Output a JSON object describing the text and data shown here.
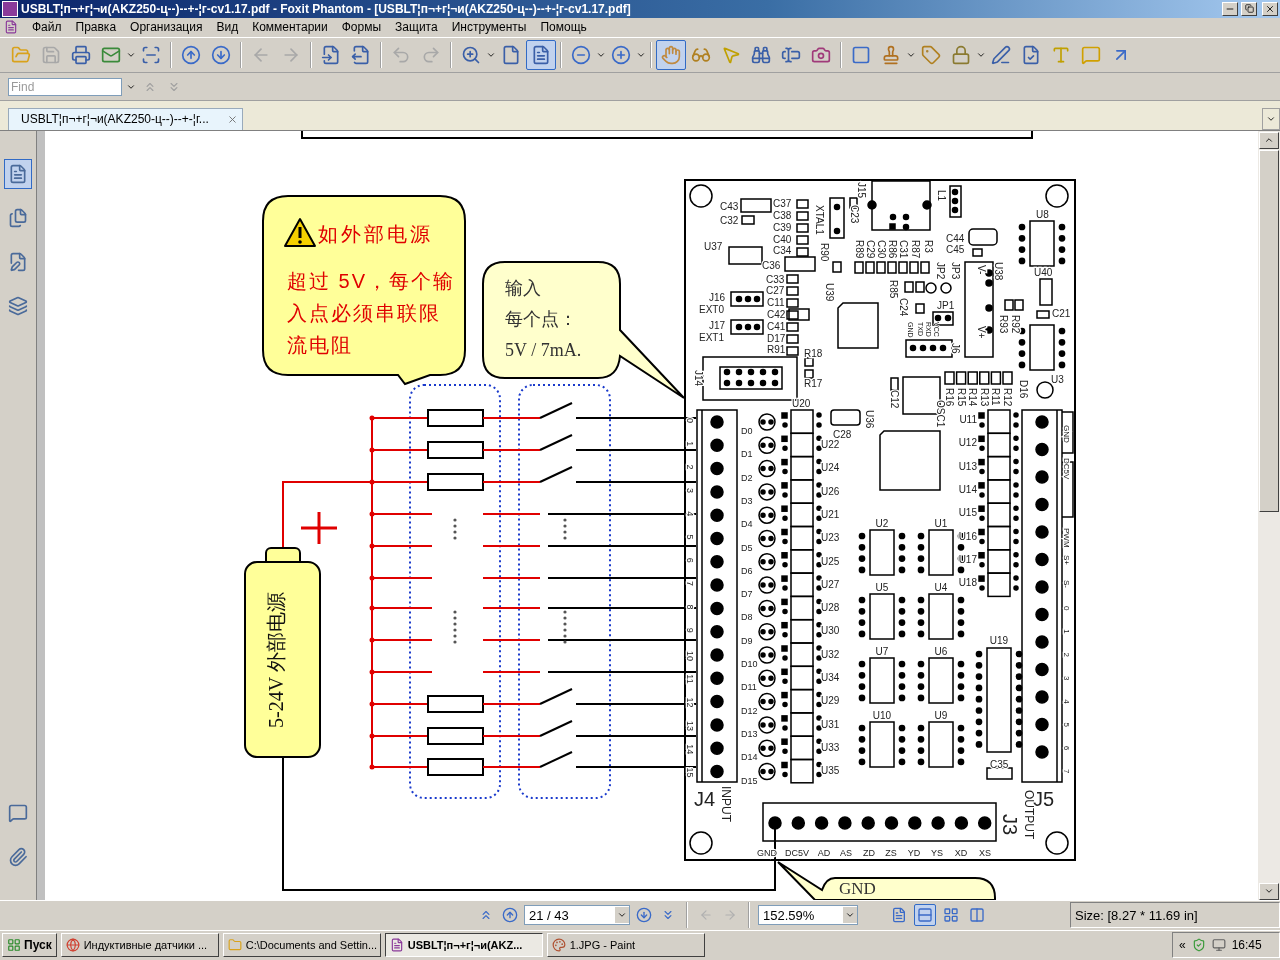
{
  "window": {
    "title": "USBLT¦п¬+г¦¬и(AKZ250-ц--)--+-¦г-cv1.17.pdf - Foxit Phantom - [USBLT¦п¬+г¦¬и(AKZ250-ц--)--+-¦г-cv1.17.pdf]"
  },
  "menu": [
    "Файл",
    "Правка",
    "Организация",
    "Вид",
    "Комментарии",
    "Формы",
    "Защита",
    "Инструменты",
    "Помощь"
  ],
  "toolbar": [
    {
      "selected": false,
      "disabled": false
    },
    {
      "selected": false,
      "disabled": true
    },
    {
      "selected": false,
      "disabled": false
    },
    {
      "selected": false,
      "disabled": false
    },
    {
      "selected": false,
      "disabled": false
    },
    {
      "selected": false,
      "disabled": false
    },
    {
      "selected": false,
      "disabled": false
    },
    {
      "selected": false,
      "disabled": true
    },
    {
      "selected": false,
      "disabled": true
    },
    {
      "selected": false,
      "disabled": false
    },
    {
      "selected": false,
      "disabled": false
    },
    {
      "selected": false,
      "disabled": true
    },
    {
      "selected": false,
      "disabled": true
    },
    {
      "selected": false,
      "disabled": false
    },
    {
      "selected": false,
      "disabled": false
    },
    {
      "selected": true,
      "disabled": false
    },
    {
      "selected": false,
      "disabled": false
    },
    {
      "selected": false,
      "disabled": false
    },
    {
      "selected": true,
      "disabled": false
    },
    {
      "selected": false,
      "disabled": false
    },
    {
      "selected": false,
      "disabled": false
    },
    {
      "selected": false,
      "disabled": false
    },
    {
      "selected": false,
      "disabled": false
    },
    {
      "selected": false,
      "disabled": false
    },
    {
      "selected": false,
      "disabled": false
    },
    {
      "selected": false,
      "disabled": false
    },
    {
      "selected": false,
      "disabled": false
    },
    {
      "selected": false,
      "disabled": false
    },
    {
      "selected": false,
      "disabled": false
    },
    {
      "selected": false,
      "disabled": false
    },
    {
      "selected": false,
      "disabled": false
    },
    {
      "selected": false,
      "disabled": false
    },
    {
      "selected": false,
      "disabled": false
    }
  ],
  "find": {
    "placeholder": "Find"
  },
  "tabs": [
    {
      "label": "USBLT¦п¬+г¦¬и(AKZ250-ц--)--+-¦г...",
      "selected": true
    }
  ],
  "sidebar": [
    {
      "selected": true
    },
    {
      "selected": false
    },
    {
      "selected": false
    },
    {
      "selected": false
    },
    {
      "selected": false
    },
    {
      "selected": false
    }
  ],
  "diagram": {
    "warning_callout": {
      "title": "如外部电源",
      "text": "超过 5V，每个输入点必须串联限流电阻"
    },
    "input_callout": {
      "lines": [
        "输入",
        "每个点：",
        "5V / 7mA."
      ]
    },
    "gnd_callout": {
      "text": "GND"
    },
    "power_supply": {
      "label": "5-24V  外部电源"
    },
    "board": {
      "labels": [
        "C43",
        "C32",
        "C37",
        "C38",
        "C39",
        "C40",
        "C34",
        "U37",
        "C36",
        "C33",
        "C27",
        "C11",
        "C42",
        "C41",
        "D17",
        "R91",
        "J16",
        "EXT0",
        "J17",
        "EXT1",
        "R18",
        "R17",
        "J14",
        "XTAL1",
        "C23",
        "R90",
        "U39",
        "J15",
        "R89",
        "C29",
        "C30",
        "R86",
        "C31",
        "R87",
        "R3",
        "R85",
        "C24",
        "JP2",
        "JP3",
        "JP1",
        "J6",
        "L1",
        "C44",
        "C45",
        "U38",
        "V-",
        "V+",
        "U8",
        "U40",
        "C21",
        "R92",
        "R93",
        "U3",
        "D16",
        "R16",
        "R15",
        "R14",
        "R13",
        "R11",
        "R12",
        "C12",
        "OSC1",
        "U36",
        "C28",
        "C35",
        "GND",
        "TXD",
        "RXD",
        "VCC"
      ],
      "input_terminal": {
        "name": "J4",
        "caption": "INPUT",
        "pins": [
          "0",
          "1",
          "2",
          "3",
          "4",
          "5",
          "6",
          "7",
          "8",
          "9",
          "10",
          "11",
          "12",
          "13",
          "14",
          "15"
        ]
      },
      "leds": [
        "D0",
        "D1",
        "D2",
        "D3",
        "D4",
        "D5",
        "D6",
        "D7",
        "D8",
        "D9",
        "D10",
        "D11",
        "D12",
        "D13",
        "D14",
        "D15"
      ],
      "input_relays": [
        "U20",
        "U22",
        "U24",
        "U26",
        "U21",
        "U23",
        "U25",
        "U27",
        "U28",
        "U30",
        "U32",
        "U34",
        "U29",
        "U31",
        "U33",
        "U35"
      ],
      "output_relays": [
        "U11",
        "U12",
        "U13",
        "U14",
        "U15",
        "U16",
        "U17",
        "U18"
      ],
      "chips": [
        "U2",
        "U1",
        "U5",
        "U4",
        "U7",
        "U6",
        "U10",
        "U9"
      ],
      "driver": "U19",
      "output_terminal": {
        "name": "J5",
        "caption": "OUTPUT",
        "pins": [
          "GND",
          "DC5V",
          "PWM",
          "S+",
          "S-",
          "0",
          "1",
          "2",
          "3",
          "4",
          "5",
          "6",
          "7"
        ]
      },
      "bottom_connector": {
        "name": "J3",
        "pins": [
          "GND",
          "DC5V",
          "AD",
          "AS",
          "ZD",
          "ZS",
          "YD",
          "YS",
          "XD",
          "XS"
        ]
      }
    }
  },
  "status_bar": {
    "page": "21 / 43",
    "zoom": "152.59%",
    "views": [
      {
        "selected": false
      },
      {
        "selected": true
      },
      {
        "selected": false
      },
      {
        "selected": false
      }
    ],
    "size": "Size: [8.27 * 11.69 in]"
  },
  "taskbar": {
    "start": "Пуск",
    "tasks": [
      {
        "label": "Индуктивные датчики ...",
        "selected": false
      },
      {
        "label": "C:\\Documents and Settin...",
        "selected": false
      },
      {
        "label": "USBLT¦п¬+г¦¬и(AKZ...",
        "selected": true
      },
      {
        "label": "1.JPG - Paint",
        "selected": false
      }
    ],
    "tray": {
      "expand": "«",
      "time": "16:45"
    }
  }
}
